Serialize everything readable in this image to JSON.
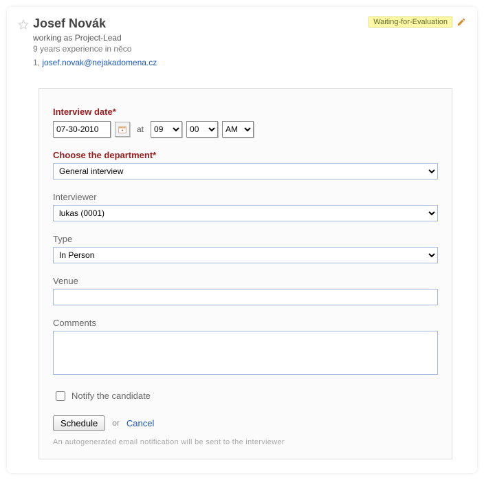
{
  "header": {
    "name": "Josef Novák",
    "role_line": "working as Project-Lead",
    "experience_line": "9 years experience in něco",
    "contact_prefix": "1, ",
    "email": "josef.novak@nejakadomena.cz",
    "status": "Waiting-for-Evaluation"
  },
  "form": {
    "interview_date_label": "Interview date*",
    "date_value": "07-30-2010",
    "at_label": "at",
    "hour": "09",
    "minute": "00",
    "ampm": "AM",
    "department_label": "Choose the department*",
    "department_value": "General interview",
    "interviewer_label": "Interviewer",
    "interviewer_value": "lukas (0001)",
    "type_label": "Type",
    "type_value": "In Person",
    "venue_label": "Venue",
    "venue_value": "",
    "comments_label": "Comments",
    "comments_value": "",
    "notify_label": "Notify the candidate",
    "schedule_label": "Schedule",
    "or_label": "or",
    "cancel_label": "Cancel",
    "footnote": "An autogenerated email notification will be sent to the interviewer"
  }
}
